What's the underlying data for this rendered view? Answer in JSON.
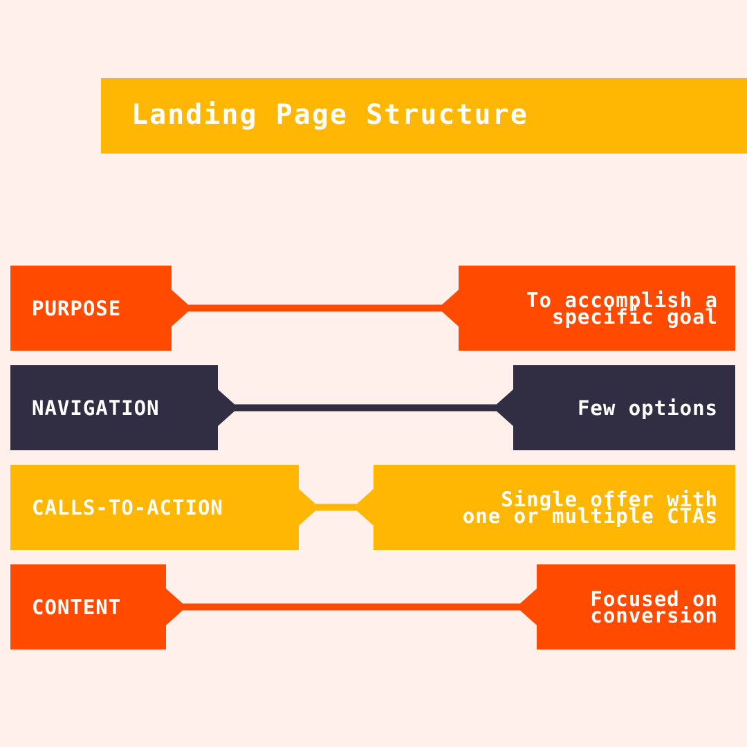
{
  "title": "Landing Page Structure",
  "colors": {
    "background": "#fff0eb",
    "orange": "#ff4a00",
    "navy": "#312e43",
    "yellow": "#ffb703",
    "text": "#ffffff"
  },
  "rows": [
    {
      "label": "PURPOSE",
      "description_lines": [
        "To accomplish a",
        "specific goal"
      ],
      "color": "#ff4a00"
    },
    {
      "label": "NAVIGATION",
      "description_lines": [
        "Few options"
      ],
      "color": "#312e43"
    },
    {
      "label": "CALLS-TO-ACTION",
      "description_lines": [
        "Single offer with",
        "one or multiple CTAs"
      ],
      "color": "#ffb703"
    },
    {
      "label": "CONTENT",
      "description_lines": [
        "Focused on",
        "conversion"
      ],
      "color": "#ff4a00"
    }
  ]
}
